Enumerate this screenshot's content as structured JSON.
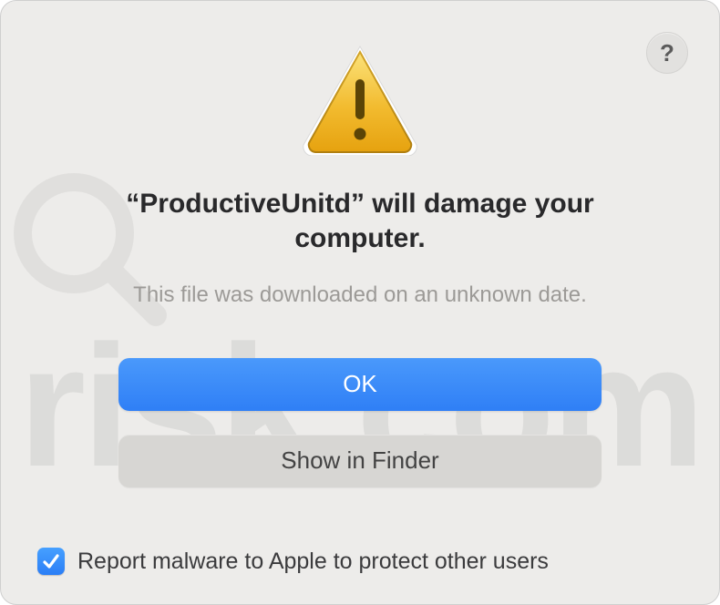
{
  "dialog": {
    "title": "“ProductiveUnitd” will damage your computer.",
    "subtitle": "This file was downloaded on an unknown date.",
    "help_label": "?"
  },
  "buttons": {
    "primary": "OK",
    "secondary": "Show in Finder"
  },
  "report": {
    "checked": true,
    "label": "Report malware to Apple to protect other users"
  },
  "colors": {
    "accent": "#2f7ff6",
    "dialog_bg": "#edecea",
    "subtitle": "#9c9a97"
  },
  "icons": {
    "warning": "warning-triangle-icon",
    "help": "help-icon",
    "checkmark": "checkmark-icon"
  },
  "watermark": {
    "text": "risk.com"
  }
}
